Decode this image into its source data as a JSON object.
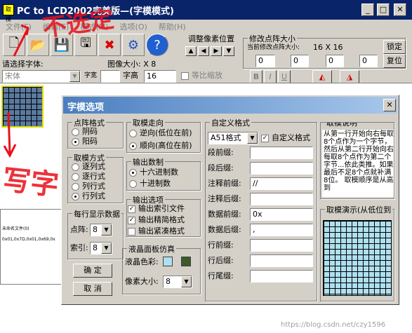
{
  "window": {
    "title": "PC to LCD2002完美版—(字模模式)",
    "icon_text": "取模"
  },
  "menu": [
    "文件(F)",
    "编辑(E)",
    "模式(M)",
    "选项(O)",
    "帮助(H)"
  ],
  "toolbar": {
    "font_label": "请选择字体:",
    "font_value": "宋体",
    "size_label": "字宽",
    "width_label": "字高",
    "width_value": "16",
    "image_size_label": "图像大小:",
    "image_size_value": "X  8",
    "proportional_label": "等比缩放",
    "pixel_adjust_label": "调整像素位置",
    "matrix_group": "修改点阵大小",
    "current_matrix_label": "当前修改点阵大小:",
    "current_matrix_value": "16  X  16",
    "lock_button": "锁定",
    "reset_button": "复位",
    "spin_value": "0",
    "style_bold": "B",
    "style_italic": "I",
    "style_underline": "U"
  },
  "dialog": {
    "title": "字模选项",
    "dot_format": {
      "title": "点阵格式",
      "options": [
        "阴码",
        "阳码"
      ],
      "selected": 1
    },
    "mode": {
      "title": "取模方式",
      "options": [
        "逐列式",
        "逐行式",
        "列行式",
        "行列式"
      ],
      "selected": 3
    },
    "direction": {
      "title": "取模走向",
      "options": [
        "逆向(低位在前)",
        "顺向(高位在前)"
      ],
      "selected": 1
    },
    "number_base": {
      "title": "输出数制",
      "options": [
        "十六进制数",
        "十进制数"
      ],
      "selected": 0
    },
    "output_options": {
      "title": "输出选项",
      "items": [
        {
          "label": "输出索引文件",
          "checked": true
        },
        {
          "label": "输出精简格式",
          "checked": true
        },
        {
          "label": "输出紧凑格式",
          "checked": false
        }
      ]
    },
    "per_line": {
      "title": "每行显示数据",
      "dot_label": "点阵:",
      "dot_value": "8",
      "index_label": "索引:",
      "index_value": "8"
    },
    "lcd": {
      "title": "液晶面板仿真",
      "color_label": "液晶色彩:",
      "pixel_label": "像素大小:",
      "pixel_value": "8"
    },
    "ok_button": "确  定",
    "cancel_button": "取  消",
    "custom": {
      "title": "自定义格式",
      "format_value": "A51格式",
      "custom_check_label": "自定义格式",
      "fields": [
        {
          "label": "段前缀:",
          "value": ""
        },
        {
          "label": "段后缀:",
          "value": ""
        },
        {
          "label": "注释前缀:",
          "value": "//"
        },
        {
          "label": "注释后缀:",
          "value": ""
        },
        {
          "label": "数据前缀:",
          "value": "0x"
        },
        {
          "label": "数据后缀:",
          "value": ","
        },
        {
          "label": "行前缀:",
          "value": ""
        },
        {
          "label": "行后缀:",
          "value": ""
        },
        {
          "label": "行尾缀:",
          "value": ""
        }
      ]
    },
    "description": {
      "title": "取模说明",
      "text": "从第一行开始向右每取8个点作为一个字节，然后从第二行开始向右每取8个点作为第二个字节...依此类推。如果最后不足8个点就补满8位。 取模顺序是从高到"
    },
    "preview": {
      "title": "取模演示(从低位到"
    }
  },
  "output_panel": {
    "name_line": "未命名文件(0)",
    "data_line": "0x01,0x7D,0x01,0x69,0x"
  },
  "annotations": {
    "top": "不选定",
    "side": "写字"
  },
  "colors": {
    "lcd_on": "#aee0f0",
    "lcd_off": "#3c5a2c",
    "title_bg": "#0a246a",
    "dialog_title_bg": "#4a7ec0"
  },
  "watermark": "https://blog.csdn.net/czy1596"
}
